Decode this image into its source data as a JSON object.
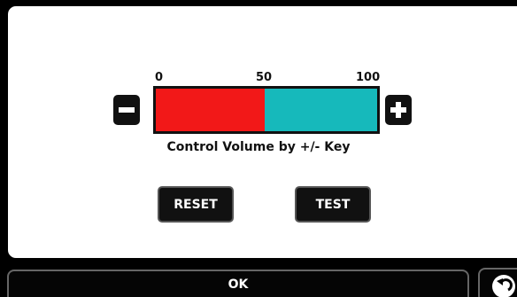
{
  "volume": {
    "scale_min": "0",
    "scale_mid": "50",
    "scale_max": "100",
    "level_fraction": 0.49,
    "caption": "Control Volume by +/- Key"
  },
  "buttons": {
    "reset_label": "RESET",
    "test_label": "TEST",
    "ok_label": "OK"
  },
  "colors": {
    "level_fill": "#f21818",
    "bar_background": "#16b9bb"
  },
  "icons": {
    "decrease": "minus-icon",
    "increase": "plus-icon",
    "back": "back-arrow-icon"
  }
}
